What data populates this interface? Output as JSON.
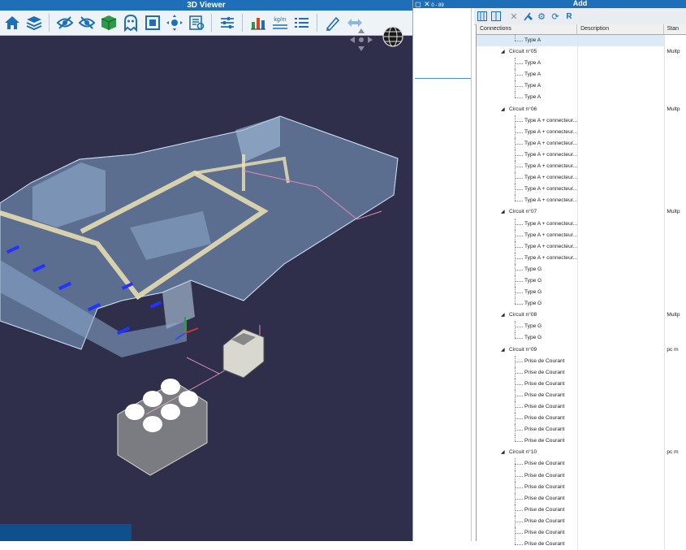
{
  "viewer": {
    "title": "3D Viewer",
    "toolbar": [
      {
        "name": "home-icon",
        "color": "#1e6fb8"
      },
      {
        "name": "layers-icon",
        "color": "#1e6fb8"
      },
      {
        "name": "show-icon",
        "color": "#1e6fb8"
      },
      {
        "name": "hide-icon",
        "color": "#1e6fb8"
      },
      {
        "name": "cube-icon",
        "color": "#2c9a4a"
      },
      {
        "name": "ghost-icon",
        "color": "#1e6fb8"
      },
      {
        "name": "fit-view-icon",
        "color": "#1e6fb8"
      },
      {
        "name": "move-icon",
        "color": "#1e6fb8"
      },
      {
        "name": "properties-icon",
        "color": "#1e6fb8"
      },
      {
        "name": "sliders-icon",
        "color": "#1e6fb8"
      },
      {
        "name": "bar-chart-icon",
        "color": "#d04a2a"
      },
      {
        "name": "weight-icon",
        "color": "#1e6fb8"
      },
      {
        "name": "list-icon",
        "color": "#1e6fb8"
      },
      {
        "name": "pen-icon",
        "color": "#1e6fb8"
      },
      {
        "name": "double-arrow-icon",
        "color": "#8fb6dc"
      }
    ],
    "weight_label": "kg/m"
  },
  "middle": {
    "title": "0 - 89 joursAvantRéac"
  },
  "right": {
    "title": "Add",
    "toolbar": [
      "columns-icon",
      "list-view-icon",
      "delete-icon",
      "clean-icon",
      "settings-icon",
      "refresh-icon",
      "r-icon"
    ],
    "columns": [
      "Connections",
      "Description",
      "Stan"
    ],
    "rows": [
      {
        "level": 2,
        "text": "Type A",
        "selected": true,
        "std": ""
      },
      {
        "level": 1,
        "text": "Circuit n°05",
        "std": "Multp"
      },
      {
        "level": 2,
        "text": "Type A",
        "std": ""
      },
      {
        "level": 2,
        "text": "Type A",
        "std": ""
      },
      {
        "level": 2,
        "text": "Type A",
        "std": ""
      },
      {
        "level": 2,
        "text": "Type A",
        "std": ""
      },
      {
        "level": 1,
        "text": "Circuit n°06",
        "std": "Multp"
      },
      {
        "level": 2,
        "text": "Type A + connecteur...",
        "std": ""
      },
      {
        "level": 2,
        "text": "Type A + connecteur...",
        "std": ""
      },
      {
        "level": 2,
        "text": "Type A + connecteur...",
        "std": ""
      },
      {
        "level": 2,
        "text": "Type A + connecteur...",
        "std": ""
      },
      {
        "level": 2,
        "text": "Type A + connecteur...",
        "std": ""
      },
      {
        "level": 2,
        "text": "Type A + connecteur...",
        "std": ""
      },
      {
        "level": 2,
        "text": "Type A + connecteur...",
        "std": ""
      },
      {
        "level": 2,
        "text": "Type A + connecteur...",
        "std": ""
      },
      {
        "level": 1,
        "text": "Circuit n°07",
        "std": "Multp"
      },
      {
        "level": 2,
        "text": "Type A + connecteur...",
        "std": ""
      },
      {
        "level": 2,
        "text": "Type A + connecteur...",
        "std": ""
      },
      {
        "level": 2,
        "text": "Type A + connecteur...",
        "std": ""
      },
      {
        "level": 2,
        "text": "Type A + connecteur...",
        "std": ""
      },
      {
        "level": 2,
        "text": "Type G",
        "std": ""
      },
      {
        "level": 2,
        "text": "Type G",
        "std": ""
      },
      {
        "level": 2,
        "text": "Type G",
        "std": ""
      },
      {
        "level": 2,
        "text": "Type G",
        "std": ""
      },
      {
        "level": 1,
        "text": "Circuit n°08",
        "std": "Multp"
      },
      {
        "level": 2,
        "text": "Type G",
        "std": ""
      },
      {
        "level": 2,
        "text": "Type G",
        "std": ""
      },
      {
        "level": 1,
        "text": "Circuit n°09",
        "std": "pc m"
      },
      {
        "level": 2,
        "text": "Prise de Courant",
        "std": ""
      },
      {
        "level": 2,
        "text": "Prise de Courant",
        "std": ""
      },
      {
        "level": 2,
        "text": "Prise de Courant",
        "std": ""
      },
      {
        "level": 2,
        "text": "Prise de Courant",
        "std": ""
      },
      {
        "level": 2,
        "text": "Prise de Courant",
        "std": ""
      },
      {
        "level": 2,
        "text": "Prise de Courant",
        "std": ""
      },
      {
        "level": 2,
        "text": "Prise de Courant",
        "std": ""
      },
      {
        "level": 2,
        "text": "Prise de Courant",
        "std": ""
      },
      {
        "level": 1,
        "text": "Circuit n°10",
        "std": "pc m"
      },
      {
        "level": 2,
        "text": "Prise de Courant",
        "std": ""
      },
      {
        "level": 2,
        "text": "Prise de Courant",
        "std": ""
      },
      {
        "level": 2,
        "text": "Prise de Courant",
        "std": ""
      },
      {
        "level": 2,
        "text": "Prise de Courant",
        "std": ""
      },
      {
        "level": 2,
        "text": "Prise de Courant",
        "std": ""
      },
      {
        "level": 2,
        "text": "Prise de Courant",
        "std": ""
      },
      {
        "level": 2,
        "text": "Prise de Courant",
        "std": ""
      },
      {
        "level": 2,
        "text": "Prise de Courant",
        "std": ""
      }
    ]
  }
}
